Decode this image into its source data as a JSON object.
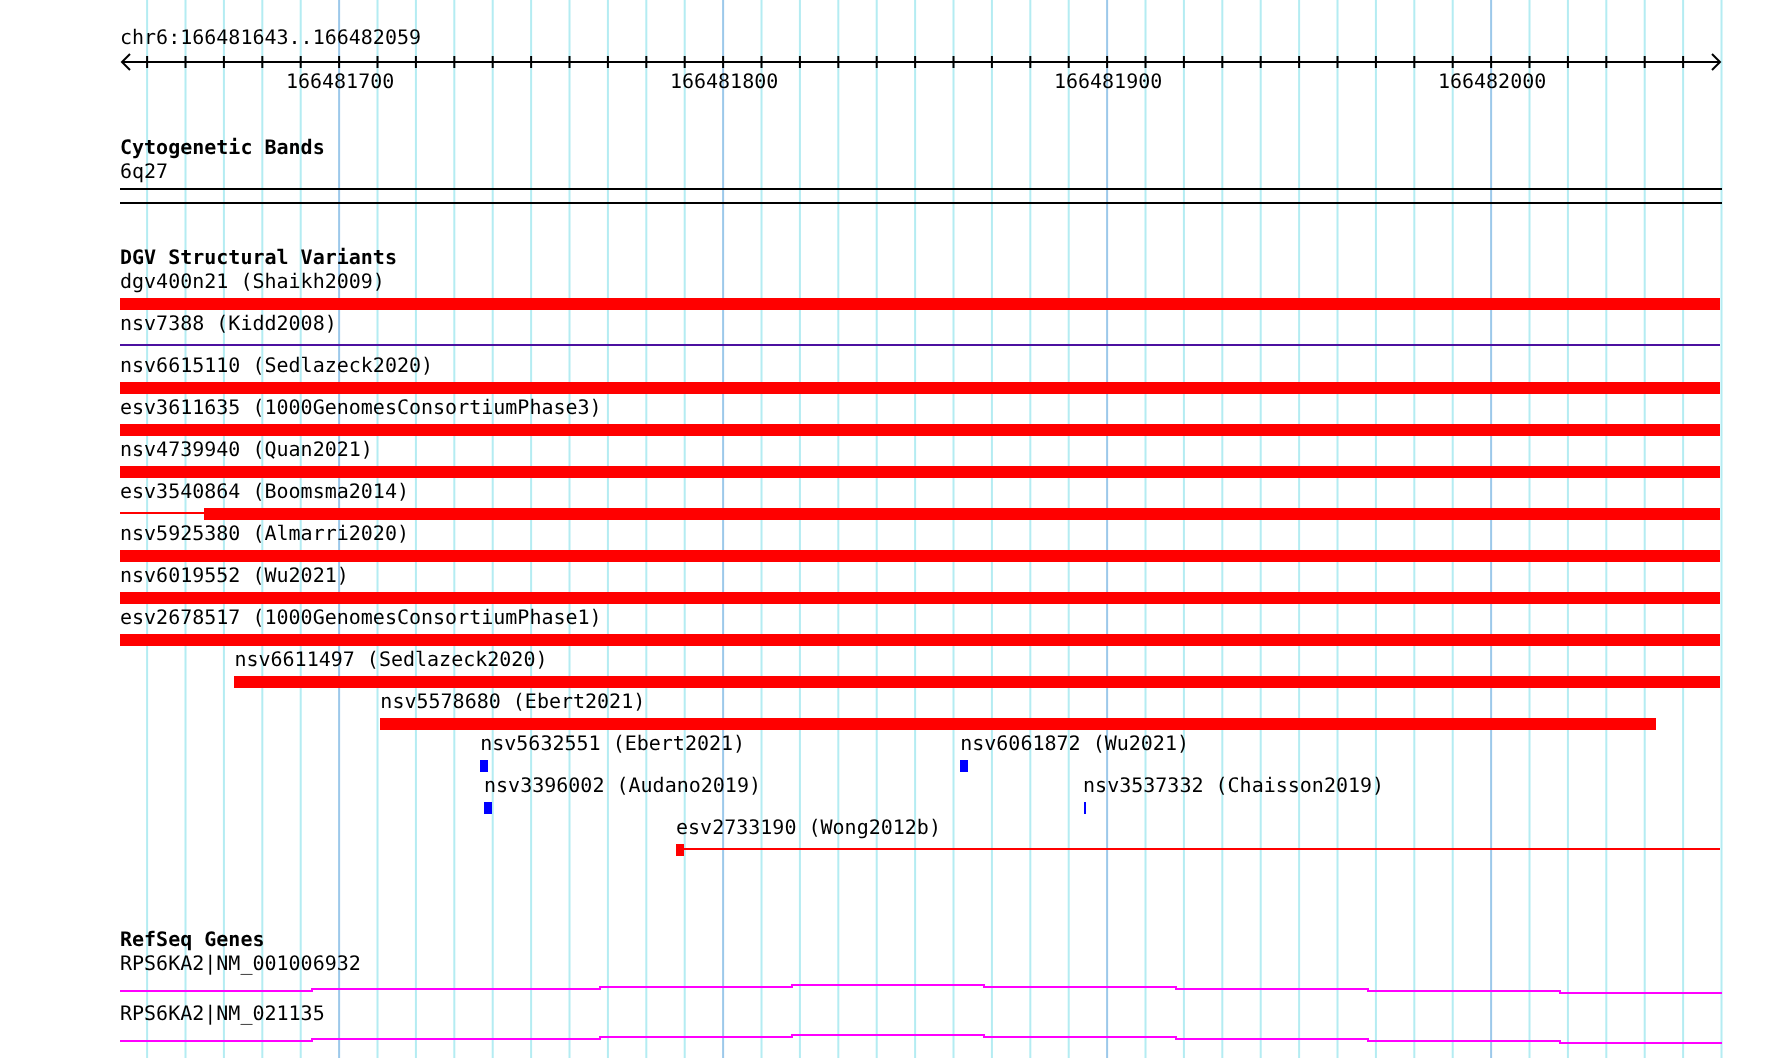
{
  "ruler": {
    "location": "chr6:166481643..166482059",
    "ticks": [
      {
        "label": "166481700"
      },
      {
        "label": "166481800"
      },
      {
        "label": "166481900"
      },
      {
        "label": "166482000"
      }
    ]
  },
  "cytogenetic_bands": {
    "title": "Cytogenetic Bands",
    "band": "6q27"
  },
  "dgv_structural_variants": {
    "title": "DGV Structural Variants",
    "rows": [
      [
        {
          "label": "dgv400n21 (Shaikh2009)",
          "kind": "bar",
          "color": "#ff0000"
        }
      ],
      [
        {
          "label": "nsv7388 (Kidd2008)",
          "kind": "line",
          "color": "#4b10a0"
        }
      ],
      [
        {
          "label": "nsv6615110 (Sedlazeck2020)",
          "kind": "bar",
          "color": "#ff0000"
        }
      ],
      [
        {
          "label": "esv3611635 (1000GenomesConsortiumPhase3)",
          "kind": "bar",
          "color": "#ff0000"
        }
      ],
      [
        {
          "label": "nsv4739940 (Quan2021)",
          "kind": "bar",
          "color": "#ff0000"
        }
      ],
      [
        {
          "label": "esv3540864 (Boomsma2014)",
          "kind": "bar",
          "color": "#ff0000"
        }
      ],
      [
        {
          "label": "nsv5925380 (Almarri2020)",
          "kind": "bar",
          "color": "#ff0000"
        }
      ],
      [
        {
          "label": "nsv6019552 (Wu2021)",
          "kind": "bar",
          "color": "#ff0000"
        }
      ],
      [
        {
          "label": "esv2678517 (1000GenomesConsortiumPhase1)",
          "kind": "bar",
          "color": "#ff0000"
        }
      ],
      [
        {
          "label": "nsv6611497 (Sedlazeck2020)",
          "kind": "bar",
          "color": "#ff0000"
        }
      ],
      [
        {
          "label": "nsv5578680 (Ebert2021)",
          "kind": "bar",
          "color": "#ff0000"
        }
      ],
      [
        {
          "label": "nsv5632551 (Ebert2021)",
          "kind": "bar",
          "color": "#0000ff"
        },
        {
          "label": "nsv6061872 (Wu2021)",
          "kind": "bar",
          "color": "#0000ff"
        }
      ],
      [
        {
          "label": "nsv3396002 (Audano2019)",
          "kind": "bar",
          "color": "#0000ff"
        },
        {
          "label": "nsv3537332 (Chaisson2019)",
          "kind": "bar",
          "color": "#0000ff"
        }
      ],
      [
        {
          "label": "esv2733190 (Wong2012b)",
          "kind": "bar",
          "color": "#ff0000"
        }
      ]
    ]
  },
  "refseq_genes": {
    "title": "RefSeq Genes",
    "transcripts": [
      {
        "label": "RPS6KA2|NM_001006932"
      },
      {
        "label": "RPS6KA2|NM_021135"
      }
    ]
  }
}
